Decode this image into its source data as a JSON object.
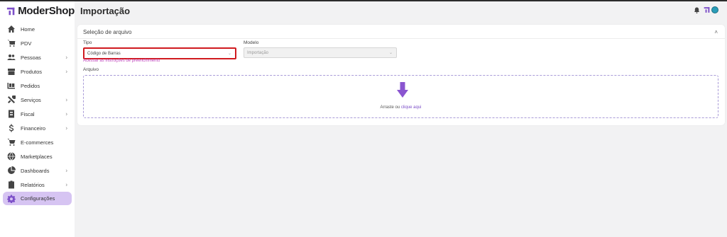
{
  "brand": {
    "name": "ModerShop",
    "accent": "#7c4fc8",
    "active_bg": "#d6c4f2"
  },
  "page": {
    "title": "Importação"
  },
  "sidebar": {
    "items": [
      {
        "label": "Home",
        "icon": "home-icon",
        "chevron": false
      },
      {
        "label": "PDV",
        "icon": "cart-icon",
        "chevron": false
      },
      {
        "label": "Pessoas",
        "icon": "people-icon",
        "chevron": true
      },
      {
        "label": "Produtos",
        "icon": "box-icon",
        "chevron": true
      },
      {
        "label": "Pedidos",
        "icon": "orders-icon",
        "chevron": false
      },
      {
        "label": "Serviços",
        "icon": "tools-icon",
        "chevron": true
      },
      {
        "label": "Fiscal",
        "icon": "fiscal-icon",
        "chevron": true
      },
      {
        "label": "Financeiro",
        "icon": "dollar-icon",
        "chevron": true
      },
      {
        "label": "E-commerces",
        "icon": "ecommerce-icon",
        "chevron": false
      },
      {
        "label": "Marketplaces",
        "icon": "globe-icon",
        "chevron": false
      },
      {
        "label": "Dashboards",
        "icon": "pie-chart-icon",
        "chevron": true
      },
      {
        "label": "Relatórios",
        "icon": "clipboard-icon",
        "chevron": true
      },
      {
        "label": "Configurações",
        "icon": "gear-icon",
        "chevron": false,
        "active": true
      }
    ]
  },
  "card": {
    "title": "Seleção de arquivo",
    "collapse_glyph": "˄",
    "tipo": {
      "label": "Tipo",
      "value": "Código de Barras",
      "arrow": "⌄"
    },
    "modelo": {
      "label": "Modelo",
      "value": "Importação",
      "arrow": "⌄"
    },
    "help_link": "Acessar as instruções de preenchimento",
    "arquivo": {
      "label": "Arquivo"
    },
    "dropzone": {
      "prefix": "Arraste ou",
      "link": "clique aqui"
    }
  },
  "chevron_glyph": "›"
}
